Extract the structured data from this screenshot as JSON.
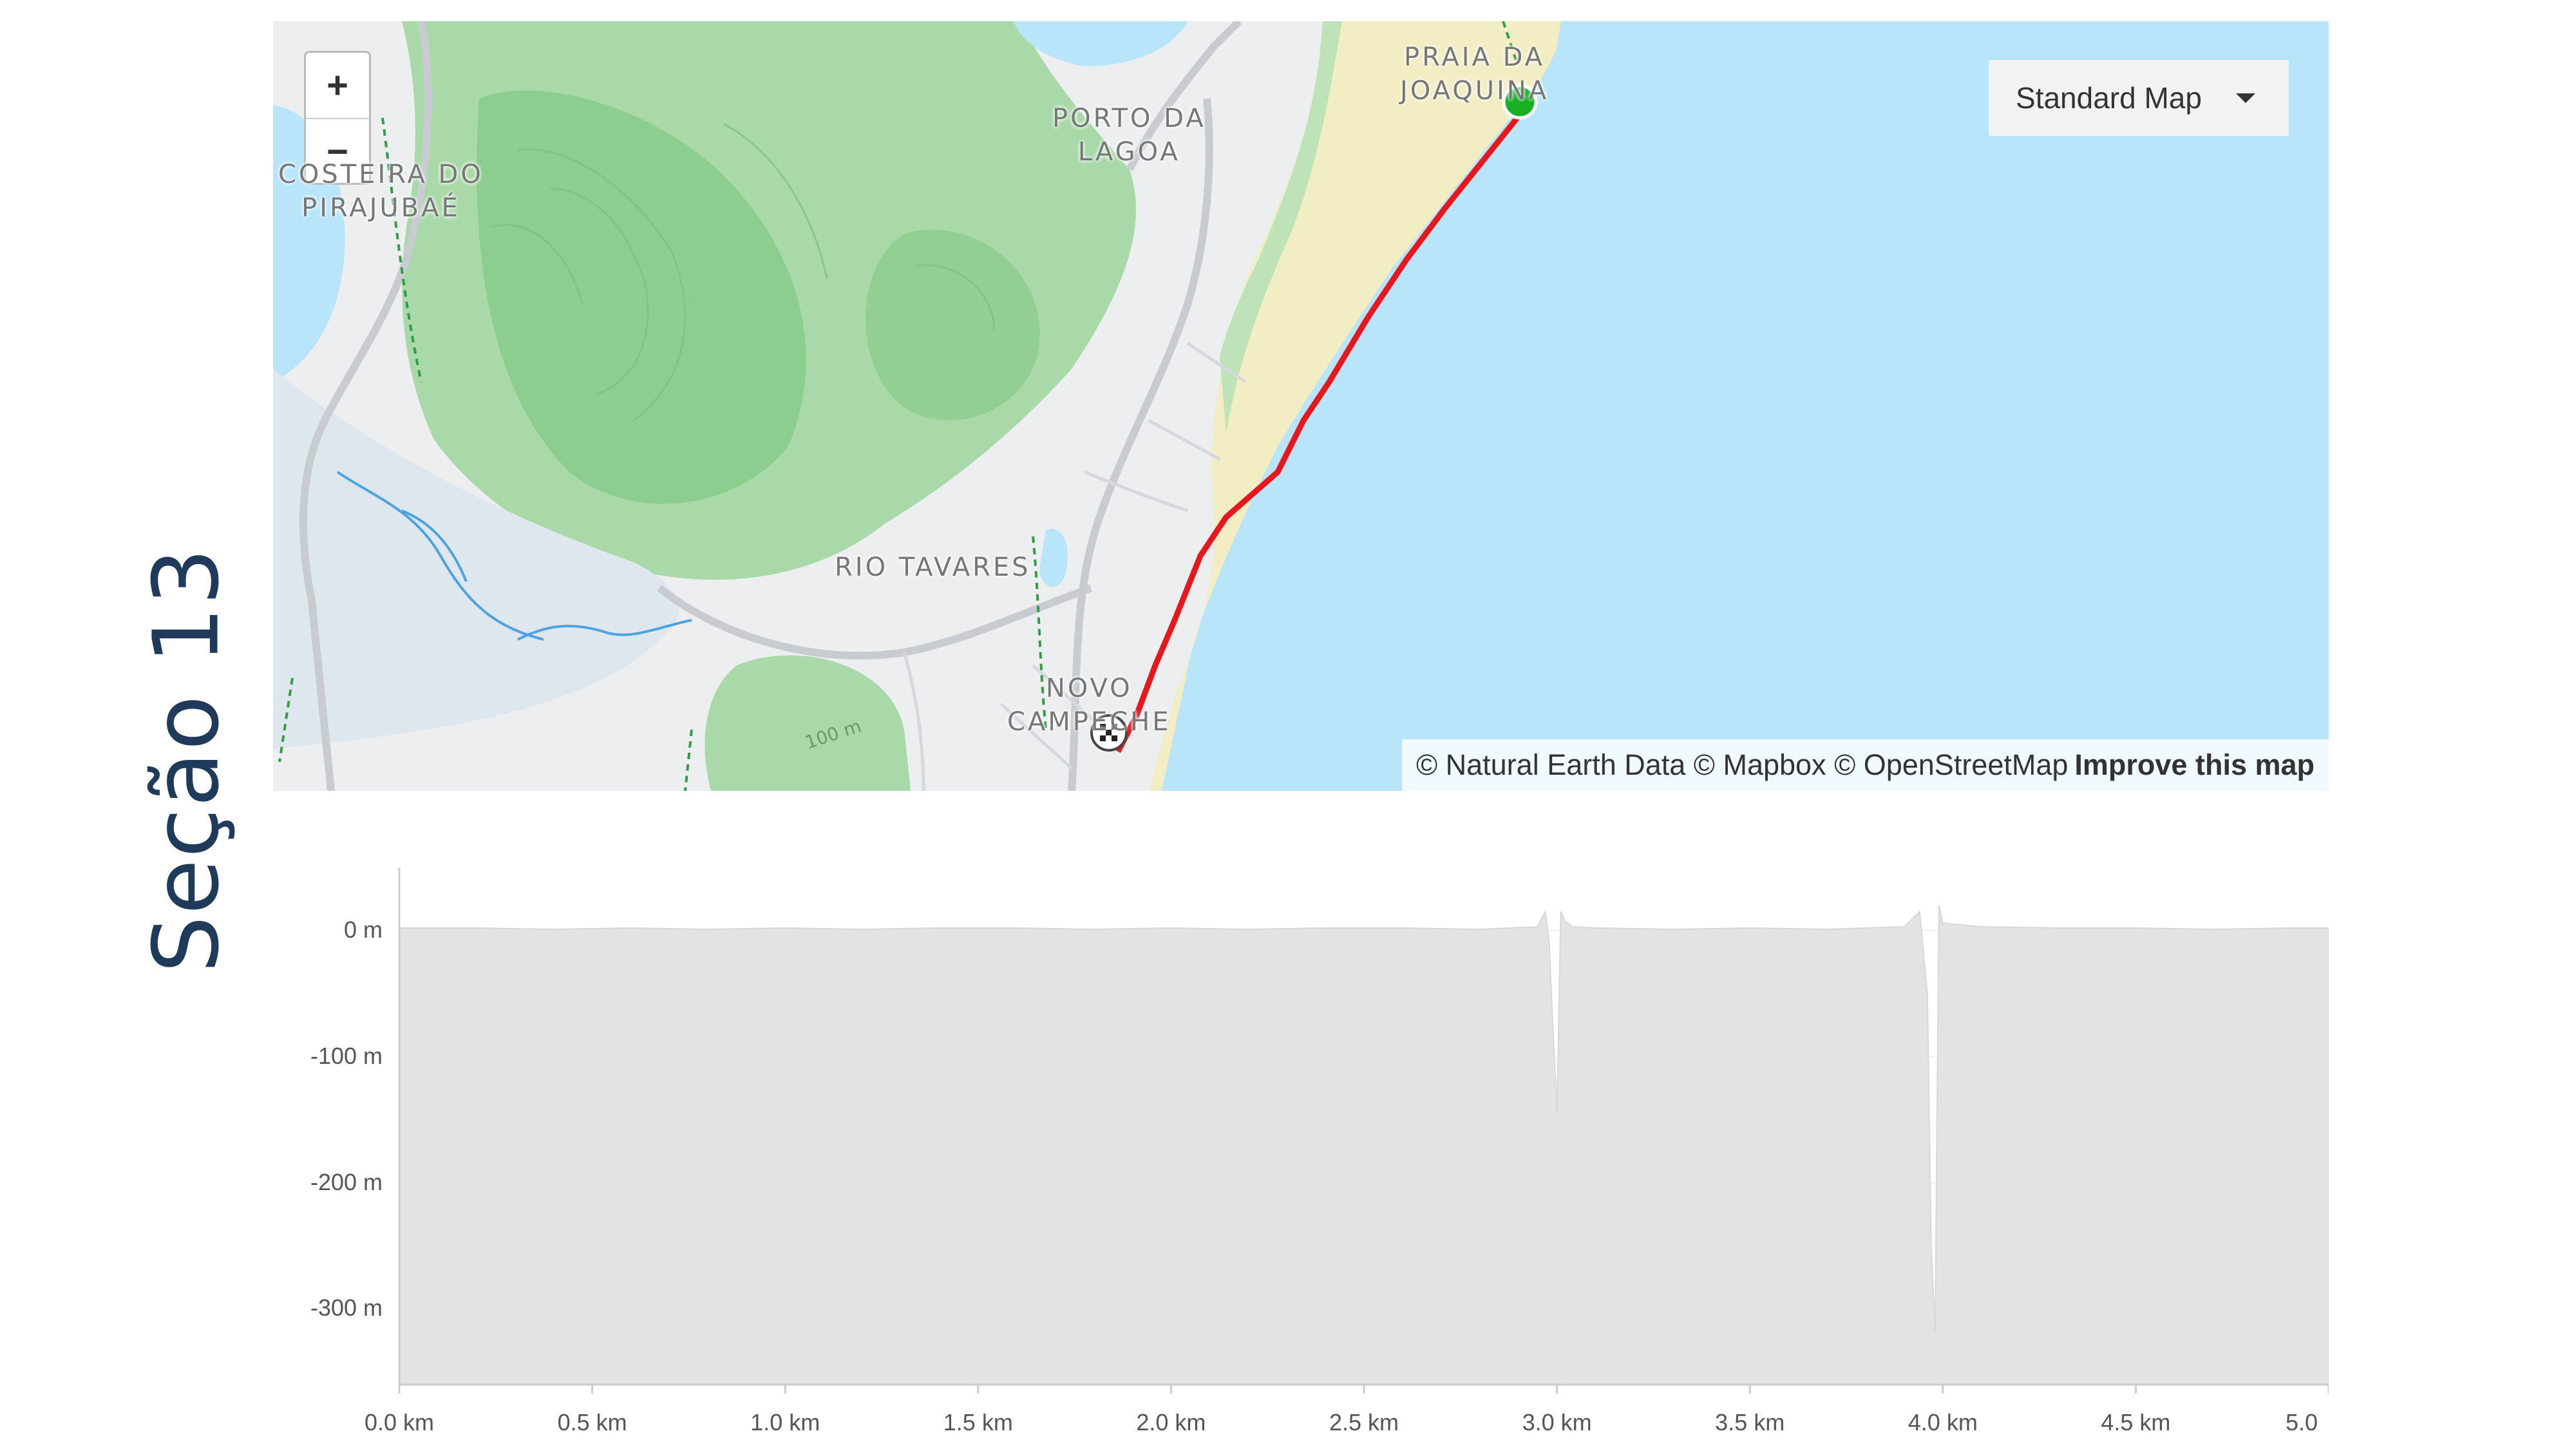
{
  "slide": {
    "title": "Seção 13"
  },
  "map": {
    "zoom_in": "+",
    "zoom_out": "−",
    "map_type": "Standard Map",
    "places": [
      {
        "text": "PRAIA DA\nJOAQUINA"
      },
      {
        "text": "PORTO DA\nLAGOA"
      },
      {
        "text": "COSTEIRA DO\nPIRAJUBAÉ"
      },
      {
        "text": "RIO TAVARES"
      },
      {
        "text": "NOVO\nCAMPECHE"
      }
    ],
    "contour_label": "100 m",
    "attribution": "© Natural Earth Data © Mapbox © OpenStreetMap",
    "improve_link": "Improve this map",
    "route_color": "#e8171d",
    "start_color": "#15b023",
    "water_color": "#b9e5fb",
    "beach_color": "#f2edc3",
    "forest_color": "#9fd6a1"
  },
  "chart_data": {
    "type": "area",
    "x_unit": "km",
    "y_unit": "m",
    "xlim": [
      0,
      5.0
    ],
    "ylim": [
      -360,
      50
    ],
    "x_ticks": [
      "0.0 km",
      "0.5 km",
      "1.0 km",
      "1.5 km",
      "2.0 km",
      "2.5 km",
      "3.0 km",
      "3.5 km",
      "4.0 km",
      "4.5 km",
      "5.0"
    ],
    "x_tick_values": [
      0,
      0.5,
      1.0,
      1.5,
      2.0,
      2.5,
      3.0,
      3.5,
      4.0,
      4.5,
      5.0
    ],
    "y_ticks": [
      "0 m",
      "-100 m",
      "-200 m",
      "-300 m"
    ],
    "y_tick_values": [
      0,
      -100,
      -200,
      -300
    ],
    "fill_color": "#e3e3e3",
    "series": [
      {
        "x": [
          0,
          0.2,
          0.4,
          0.6,
          0.8,
          1.0,
          1.2,
          1.4,
          1.6,
          1.8,
          2.0,
          2.2,
          2.4,
          2.6,
          2.8,
          2.95,
          2.97,
          2.98,
          2.99,
          3.0,
          3.01,
          3.02,
          3.04,
          3.1,
          3.3,
          3.5,
          3.7,
          3.9,
          3.94,
          3.96,
          3.97,
          3.98,
          3.99,
          4.0,
          4.1,
          4.3,
          4.5,
          4.7,
          4.9,
          5.0
        ],
        "y": [
          2,
          2,
          1,
          2,
          1,
          2,
          1,
          2,
          2,
          1,
          2,
          1,
          2,
          2,
          1,
          3,
          15,
          -10,
          -80,
          -145,
          15,
          8,
          3,
          2,
          1,
          2,
          1,
          3,
          15,
          -50,
          -250,
          -320,
          20,
          6,
          3,
          2,
          2,
          1,
          2,
          2
        ]
      }
    ]
  }
}
